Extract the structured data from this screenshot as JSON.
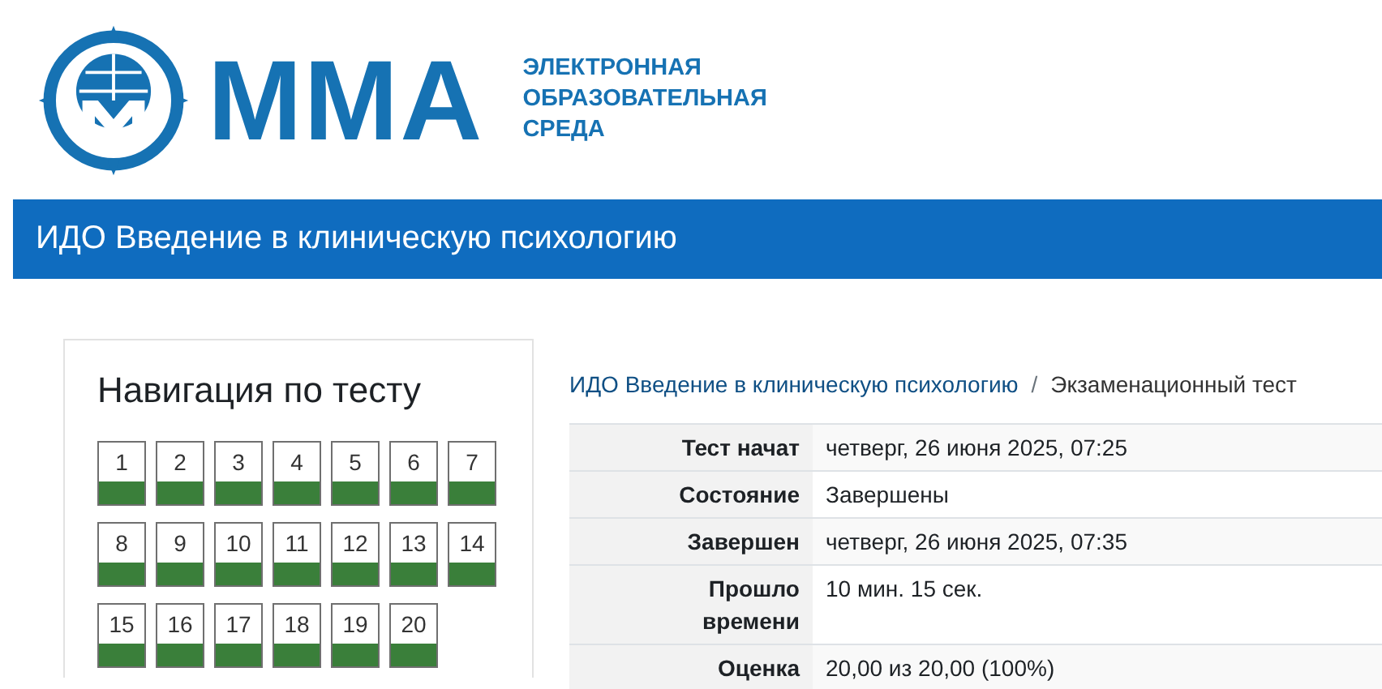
{
  "logo": {
    "wordmark": "ММА",
    "subtitle": [
      "ЭЛЕКТРОННАЯ",
      "ОБРАЗОВАТЕЛЬНАЯ",
      "СРЕДА"
    ]
  },
  "course_bar": {
    "title": "ИДО Введение в клиническую психологию"
  },
  "quiz_navigation": {
    "title": "Навигация по тесту",
    "questions": [
      {
        "label": "1",
        "correct": true
      },
      {
        "label": "2",
        "correct": true
      },
      {
        "label": "3",
        "correct": true
      },
      {
        "label": "4",
        "correct": true
      },
      {
        "label": "5",
        "correct": true
      },
      {
        "label": "6",
        "correct": true
      },
      {
        "label": "7",
        "correct": true
      },
      {
        "label": "8",
        "correct": true
      },
      {
        "label": "9",
        "correct": true
      },
      {
        "label": "10",
        "correct": true
      },
      {
        "label": "11",
        "correct": true
      },
      {
        "label": "12",
        "correct": true
      },
      {
        "label": "13",
        "correct": true
      },
      {
        "label": "14",
        "correct": true
      },
      {
        "label": "15",
        "correct": true
      },
      {
        "label": "16",
        "correct": true
      },
      {
        "label": "17",
        "correct": true
      },
      {
        "label": "18",
        "correct": true
      },
      {
        "label": "19",
        "correct": true
      },
      {
        "label": "20",
        "correct": true
      }
    ]
  },
  "breadcrumb_separator": "/",
  "breadcrumb": [
    {
      "label": "ИДО Введение в клиническую психологию",
      "kind": "link"
    },
    {
      "label": "Экзаменационный тест",
      "kind": "current"
    }
  ],
  "summary": [
    {
      "label": "Тест начат",
      "value": "четверг, 26 июня 2025, 07:25"
    },
    {
      "label": "Состояние",
      "value": "Завершены"
    },
    {
      "label": "Завершен",
      "value": "четверг, 26 июня 2025, 07:35"
    },
    {
      "label": "Прошло времени",
      "value": "10 мин. 15 сек."
    },
    {
      "label": "Оценка",
      "value": "20,00 из 20,00 (100%)"
    }
  ]
}
